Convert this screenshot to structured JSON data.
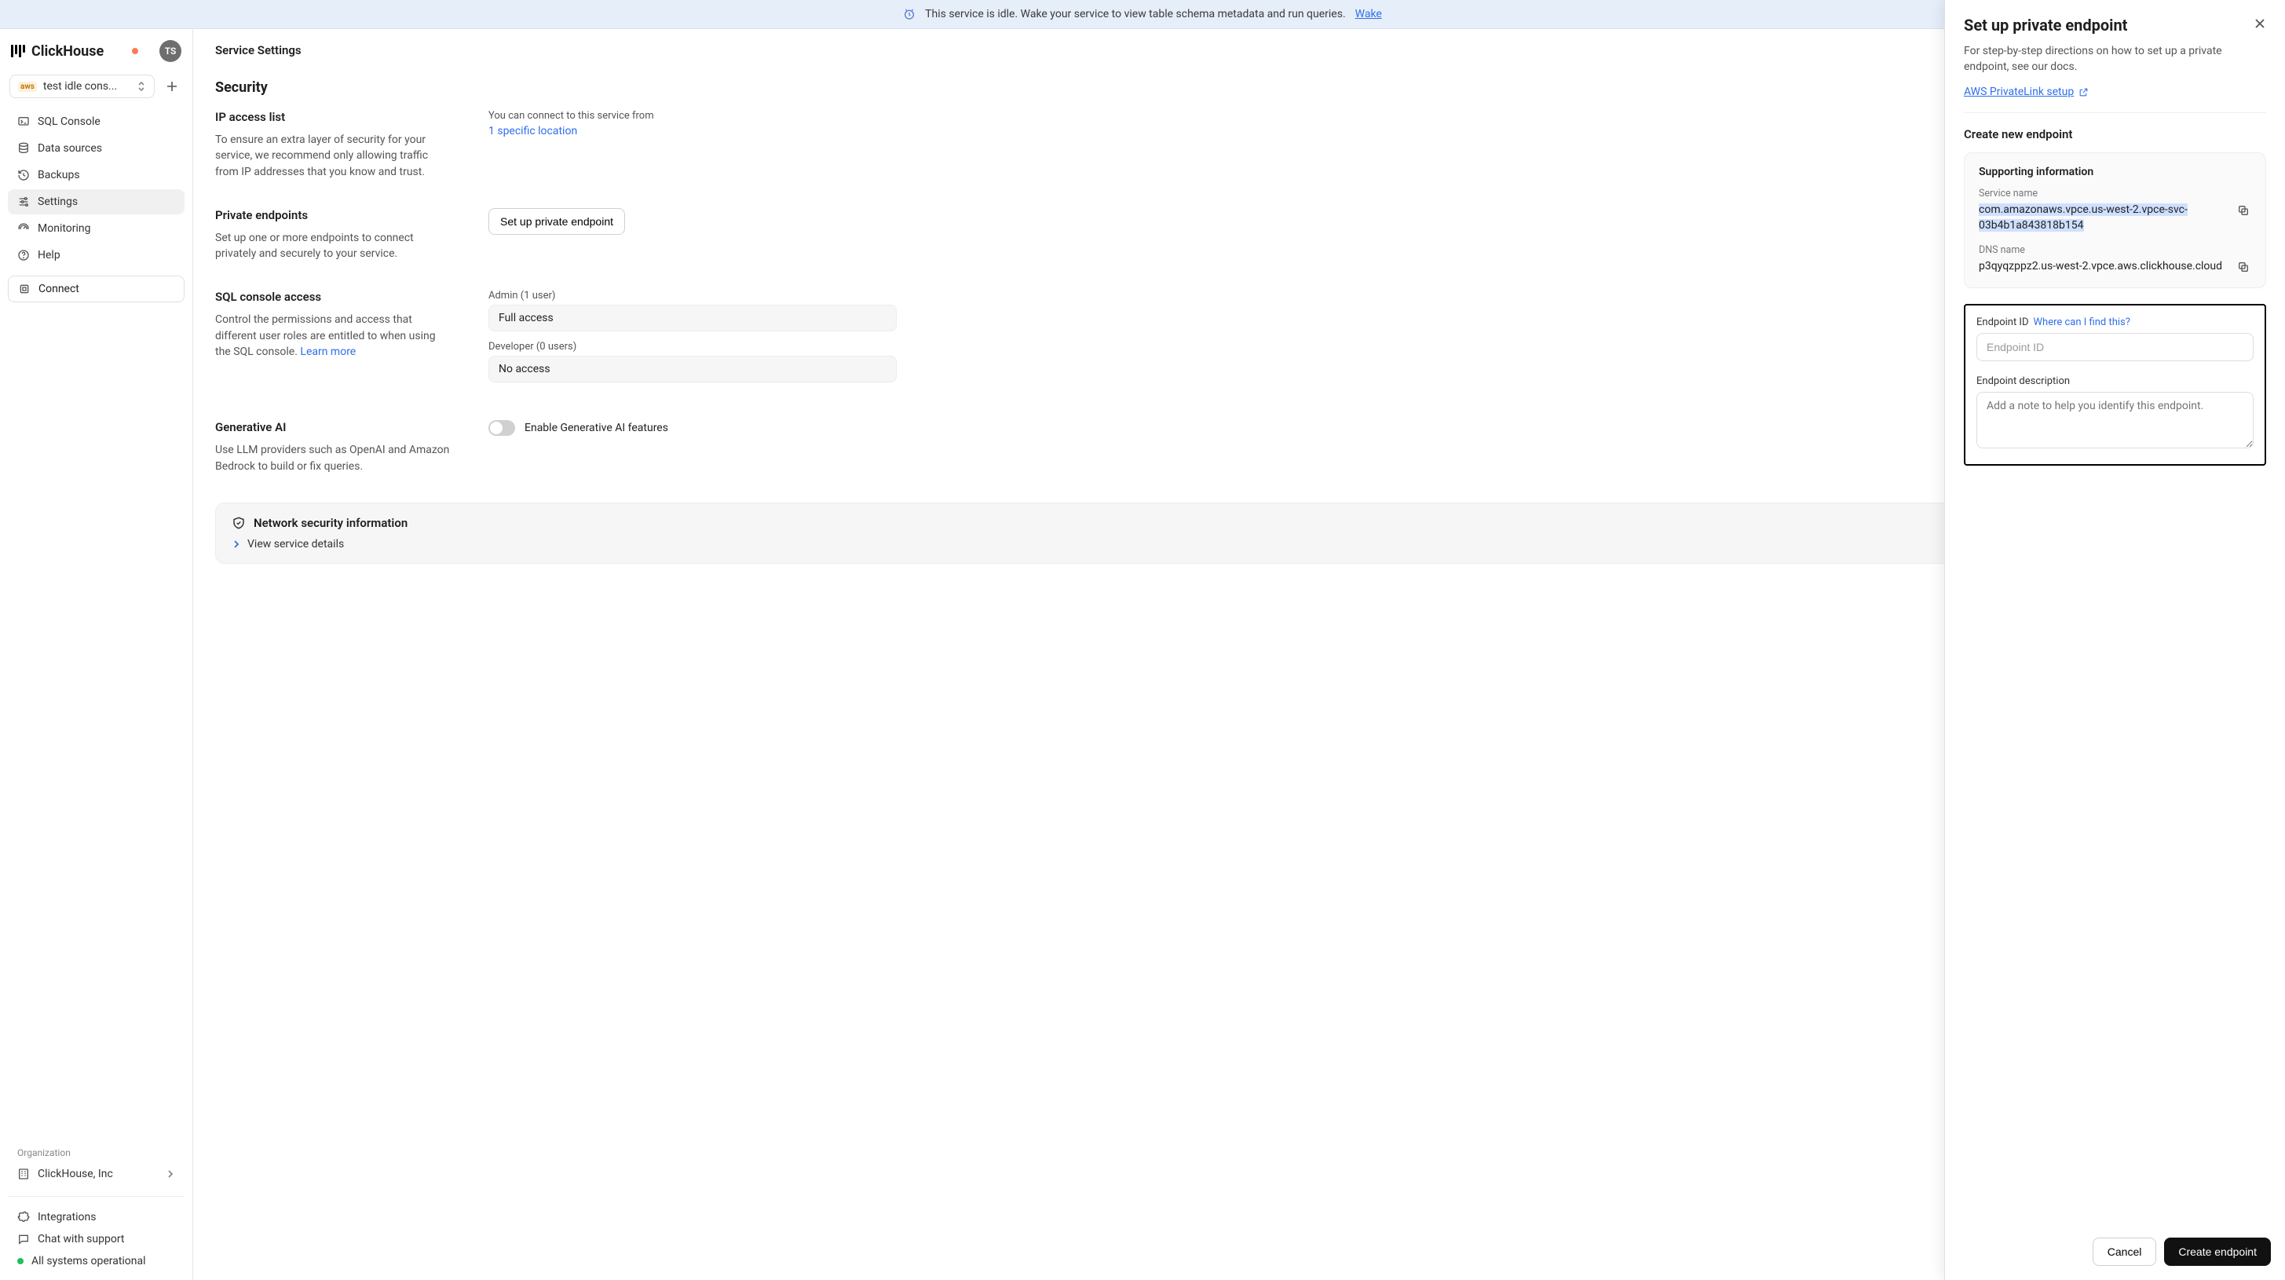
{
  "banner": {
    "text": "This service is idle. Wake your service to view table schema metadata and run queries.",
    "wake_link": "Wake"
  },
  "brand": {
    "name": "ClickHouse",
    "avatar_initials": "TS"
  },
  "service_selector": {
    "provider_badge": "aws",
    "name": "test idle cons..."
  },
  "nav": {
    "items": [
      {
        "label": "SQL Console"
      },
      {
        "label": "Data sources"
      },
      {
        "label": "Backups"
      },
      {
        "label": "Settings"
      },
      {
        "label": "Monitoring"
      },
      {
        "label": "Help"
      }
    ],
    "connect": "Connect"
  },
  "organization": {
    "label": "Organization",
    "name": "ClickHouse, Inc"
  },
  "footer": {
    "integrations": "Integrations",
    "chat": "Chat with support",
    "status": "All systems operational"
  },
  "page": {
    "title": "Service Settings",
    "section": "Security",
    "ip_access": {
      "title": "IP access list",
      "desc": "To ensure an extra layer of security for your service, we recommend only allowing traffic from IP addresses that you know and trust.",
      "right_label": "You can connect to this service from",
      "location_link": "1 specific location"
    },
    "private_endpoints": {
      "title": "Private endpoints",
      "desc": "Set up one or more endpoints to connect privately and securely to your service.",
      "button": "Set up private endpoint"
    },
    "sql_access": {
      "title": "SQL console access",
      "desc": "Control the permissions and access that different user roles are entitled to when using the SQL console.",
      "learn_more": "Learn more",
      "admin_label": "Admin (1 user)",
      "admin_value": "Full access",
      "dev_label": "Developer (0 users)",
      "dev_value": "No access"
    },
    "gen_ai": {
      "title": "Generative AI",
      "desc": "Use LLM providers such as OpenAI and Amazon Bedrock to build or fix queries.",
      "toggle_label": "Enable Generative AI features"
    },
    "network_card": {
      "title": "Network security information",
      "view": "View service details"
    }
  },
  "drawer": {
    "title": "Set up private endpoint",
    "sub": "For step-by-step directions on how to set up a private endpoint, see our docs.",
    "doc_link": "AWS PrivateLink setup",
    "create_title": "Create new endpoint",
    "support": {
      "title": "Supporting information",
      "service_name_label": "Service name",
      "service_name_value": "com.amazonaws.vpce.us-west-2.vpce-svc-03b4b1a843818b154",
      "dns_label": "DNS name",
      "dns_value": "p3qyqzppz2.us-west-2.vpce.aws.clickhouse.cloud"
    },
    "form": {
      "endpoint_id_label": "Endpoint ID",
      "endpoint_id_help": "Where can I find this?",
      "endpoint_id_placeholder": "Endpoint ID",
      "desc_label": "Endpoint description",
      "desc_placeholder": "Add a note to help you identify this endpoint."
    },
    "actions": {
      "cancel": "Cancel",
      "create": "Create endpoint"
    }
  }
}
